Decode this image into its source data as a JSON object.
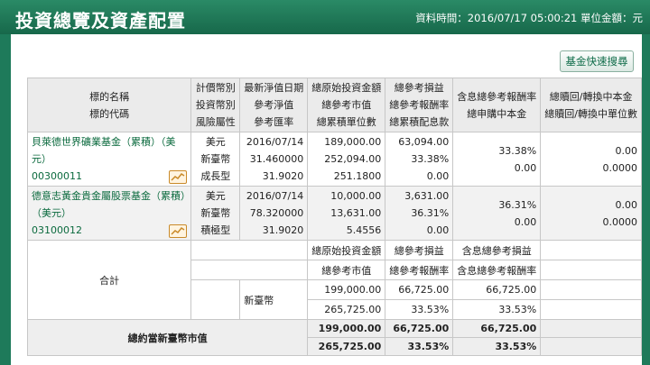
{
  "header": {
    "title": "投資總覽及資產配置",
    "data_time": "資料時間：2016/07/17 05:00:21 單位金額：元"
  },
  "toolbar": {
    "quick_search": "基金快速搜尋"
  },
  "table": {
    "headers": [
      [
        "標的名稱",
        "標的代碼"
      ],
      [
        "計價幣別",
        "投資幣別",
        "風險屬性"
      ],
      [
        "最新淨值日期",
        "參考淨值",
        "參考匯率"
      ],
      [
        "總原始投資金額",
        "總參考市值",
        "總累積單位數"
      ],
      [
        "總參考損益",
        "總參考報酬率",
        "總累積配息款"
      ],
      [
        "含息總參考報酬率",
        "總申購中本金"
      ],
      [
        "總贖回/轉換中本金",
        "總贖回/轉換中單位數"
      ]
    ],
    "rows": [
      {
        "name": "貝萊德世界礦業基金（累積）（美元）",
        "code": "00300011",
        "currency": [
          "美元",
          "新臺幣",
          "成長型"
        ],
        "nav": [
          "2016/07/14",
          "31.460000",
          "31.9020"
        ],
        "amounts": [
          "189,000.00",
          "252,094.00",
          "251.1800"
        ],
        "profit": [
          "63,094.00",
          "33.38%",
          "0.00"
        ],
        "return_incl": [
          "33.38%",
          "0.00"
        ],
        "redeem": [
          "0.00",
          "0.0000"
        ]
      },
      {
        "name": "德意志黃金貴金屬股票基金（累積）（美元）",
        "code": "03100012",
        "currency": [
          "美元",
          "新臺幣",
          "積極型"
        ],
        "nav": [
          "2016/07/14",
          "78.320000",
          "31.9020"
        ],
        "amounts": [
          "10,000.00",
          "13,631.00",
          "5.4556"
        ],
        "profit": [
          "3,631.00",
          "36.31%",
          "0.00"
        ],
        "return_incl": [
          "36.31%",
          "0.00"
        ],
        "redeem": [
          "0.00",
          "0.0000"
        ]
      }
    ],
    "summary": {
      "label": "合計",
      "sub_headers": [
        [
          "總原始投資金額",
          "總參考損益",
          "含息總參考損益"
        ],
        [
          "總參考市值",
          "總參考報酬率",
          "含息總參考報酬率"
        ]
      ],
      "currency": "新臺幣",
      "values": [
        [
          "199,000.00",
          "66,725.00",
          "66,725.00"
        ],
        [
          "265,725.00",
          "33.53%",
          "33.53%"
        ]
      ]
    },
    "total": {
      "label": "總約當新臺幣市值",
      "values": [
        [
          "199,000.00",
          "66,725.00",
          "66,725.00"
        ],
        [
          "265,725.00",
          "33.53%",
          "33.53%"
        ]
      ]
    }
  },
  "icons": {
    "fund_chart": "trend-chart-icon"
  },
  "colors": {
    "brand_green": "#1e7a5a",
    "link_green": "#0b6a3e",
    "icon_orange": "#c98a2a"
  }
}
